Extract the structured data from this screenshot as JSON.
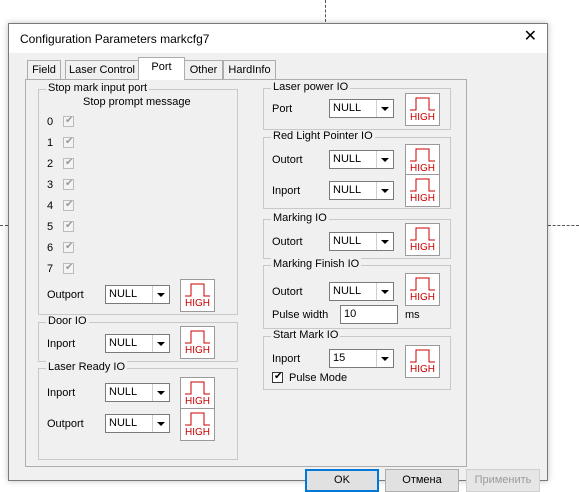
{
  "window": {
    "title": "Configuration Parameters markcfg7",
    "close_glyph": "✕"
  },
  "tabs": [
    {
      "label": "Field"
    },
    {
      "label": "Laser Control"
    },
    {
      "label": "Port"
    },
    {
      "label": "Other"
    },
    {
      "label": "HardInfo"
    }
  ],
  "high_label": "HIGH",
  "stop_mark": {
    "title": "Stop mark input port",
    "subtitle": "Stop prompt message",
    "ports": [
      {
        "num": "0",
        "checked": true
      },
      {
        "num": "1",
        "checked": true
      },
      {
        "num": "2",
        "checked": true
      },
      {
        "num": "3",
        "checked": true
      },
      {
        "num": "4",
        "checked": true
      },
      {
        "num": "5",
        "checked": true
      },
      {
        "num": "6",
        "checked": true
      },
      {
        "num": "7",
        "checked": true
      }
    ],
    "outport_label": "Outport",
    "outport_value": "NULL"
  },
  "door_io": {
    "title": "Door IO",
    "inport_label": "Inport",
    "inport_value": "NULL"
  },
  "laser_ready_io": {
    "title": "Laser Ready IO",
    "inport_label": "Inport",
    "inport_value": "NULL",
    "outport_label": "Outport",
    "outport_value": "NULL"
  },
  "laser_power_io": {
    "title": "Laser power IO",
    "port_label": "Port",
    "port_value": "NULL"
  },
  "red_light_io": {
    "title": "Red Light Pointer IO",
    "outport_label": "Outort",
    "outport_value": "NULL",
    "inport_label": "Inport",
    "inport_value": "NULL"
  },
  "marking_io": {
    "title": "Marking IO",
    "outport_label": "Outort",
    "outport_value": "NULL"
  },
  "marking_finish_io": {
    "title": "Marking Finish IO",
    "outport_label": "Outort",
    "outport_value": "NULL",
    "pulse_label": "Pulse width",
    "pulse_value": "10",
    "pulse_unit": "ms"
  },
  "start_mark_io": {
    "title": "Start Mark IO",
    "inport_label": "Inport",
    "inport_value": "15",
    "pulse_mode_label": "Pulse Mode",
    "pulse_mode_checked": true
  },
  "buttons": {
    "ok": "OK",
    "cancel": "Отмена",
    "apply": "Применить"
  }
}
